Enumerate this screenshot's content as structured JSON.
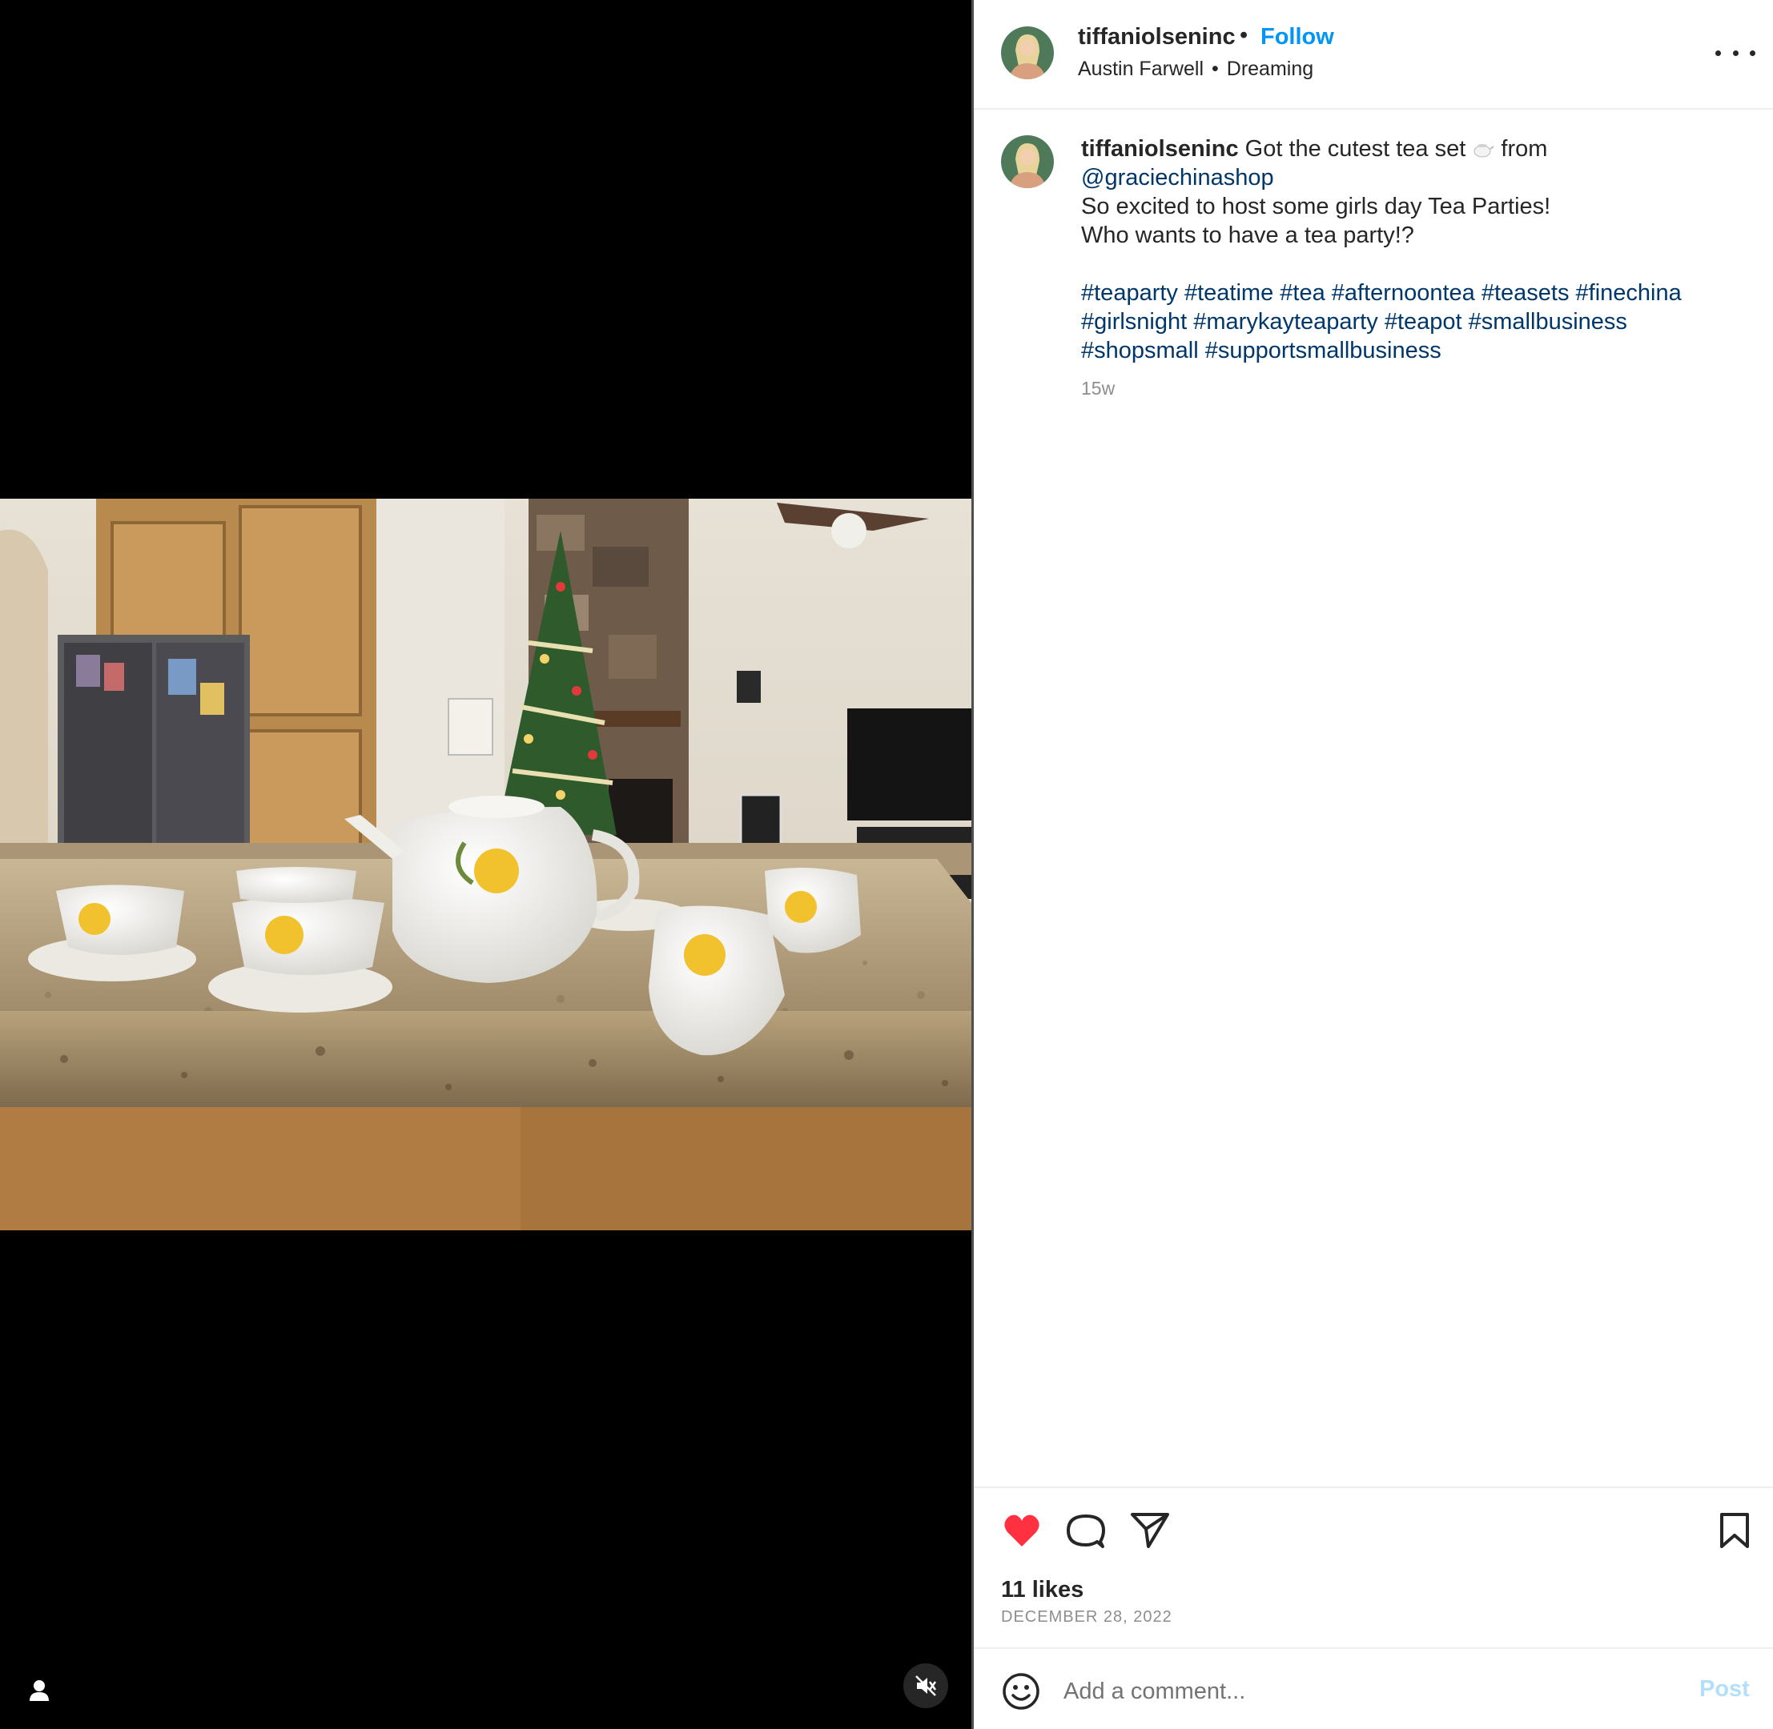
{
  "header": {
    "username": "tiffaniolseninc",
    "separator": "•",
    "follow_label": "Follow",
    "audio_artist": "Austin Farwell",
    "audio_separator": "•",
    "audio_track": "Dreaming",
    "more_icon": "more-horizontal-icon"
  },
  "caption": {
    "username": "tiffaniolseninc",
    "text_1": "Got the cutest tea set",
    "emoji": "teapot-emoji",
    "text_2": "from",
    "mention": "@graciechinashop",
    "line_2": "So excited to host some girls day Tea Parties!",
    "line_3": "Who wants to have a tea party!?",
    "hashtags": [
      "#teaparty",
      "#teatime",
      "#tea",
      "#afternoontea",
      "#teasets",
      "#finechina",
      "#girlsnight",
      "#marykayteaparty",
      "#teapot",
      "#smallbusiness",
      "#shopsmall",
      "#supportsmallbusiness"
    ],
    "time_ago": "15w"
  },
  "actions": {
    "like_icon": "heart-filled-icon",
    "comment_icon": "comment-icon",
    "share_icon": "share-icon",
    "save_icon": "bookmark-icon",
    "like_color": "#ff3040"
  },
  "stats": {
    "likes": "11 likes",
    "date": "DECEMBER 28, 2022"
  },
  "comment": {
    "placeholder": "Add a comment...",
    "post_label": "Post"
  },
  "media": {
    "user_tag_icon": "user-tag-icon",
    "mute_icon": "muted-speaker-icon"
  },
  "colors": {
    "link": "#00376b",
    "follow": "#0095f6",
    "post_disabled": "#b2dffc",
    "muted_text": "#8e8e8e"
  }
}
